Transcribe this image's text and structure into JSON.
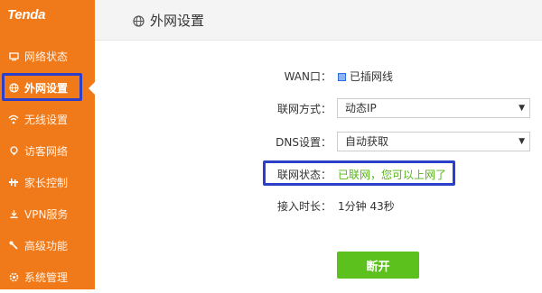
{
  "brand": "Tenda",
  "sidebar": {
    "items": [
      {
        "label": "网络状态",
        "icon": "network-status-icon"
      },
      {
        "label": "外网设置",
        "icon": "globe-icon"
      },
      {
        "label": "无线设置",
        "icon": "wifi-icon"
      },
      {
        "label": "访客网络",
        "icon": "guest-icon"
      },
      {
        "label": "家长控制",
        "icon": "parental-icon"
      },
      {
        "label": "VPN服务",
        "icon": "vpn-icon"
      },
      {
        "label": "高级功能",
        "icon": "tools-icon"
      },
      {
        "label": "系统管理",
        "icon": "settings-icon"
      }
    ],
    "active_index": 1
  },
  "header": {
    "title": "外网设置"
  },
  "form": {
    "wan_label": "WAN口：",
    "wan_value": "已插网线",
    "mode_label": "联网方式：",
    "mode_value": "动态IP",
    "dns_label": "DNS设置：",
    "dns_value": "自动获取",
    "status_label": "联网状态：",
    "status_value": "已联网，您可以上网了",
    "uptime_label": "接入时长：",
    "uptime_value": "1分钟 43秒"
  },
  "actions": {
    "disconnect_label": "断开"
  },
  "colors": {
    "sidebar": "#f07a1a",
    "highlight": "#2b3fc9",
    "ok": "#57b31a",
    "button": "#5cc11d"
  }
}
